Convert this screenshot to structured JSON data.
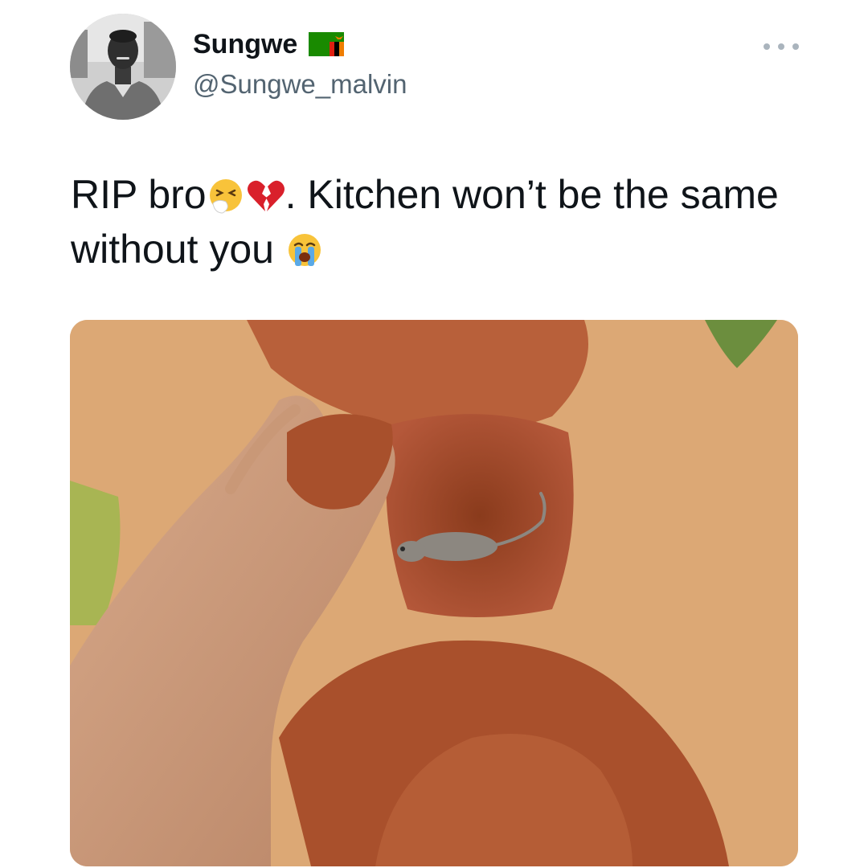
{
  "author": {
    "display_name": "Sungwe",
    "handle": "@Sungwe_malvin",
    "avatar_icon": "profile-photo",
    "flag_icon": "zambia-flag-icon"
  },
  "tweet": {
    "text_part1": "RIP bro",
    "text_part2": ". Kitchen won’t be the same without you",
    "emojis": [
      "sneezing-face-emoji",
      "broken-heart-emoji",
      "loudly-crying-face-emoji"
    ]
  },
  "media": {
    "description_icon": "photo-hand-burying-mouse-in-dirt"
  },
  "colors": {
    "text": "#0f1419",
    "secondary_text": "#536471",
    "soil_light": "#d9a16c",
    "soil_dark": "#a8502c"
  }
}
